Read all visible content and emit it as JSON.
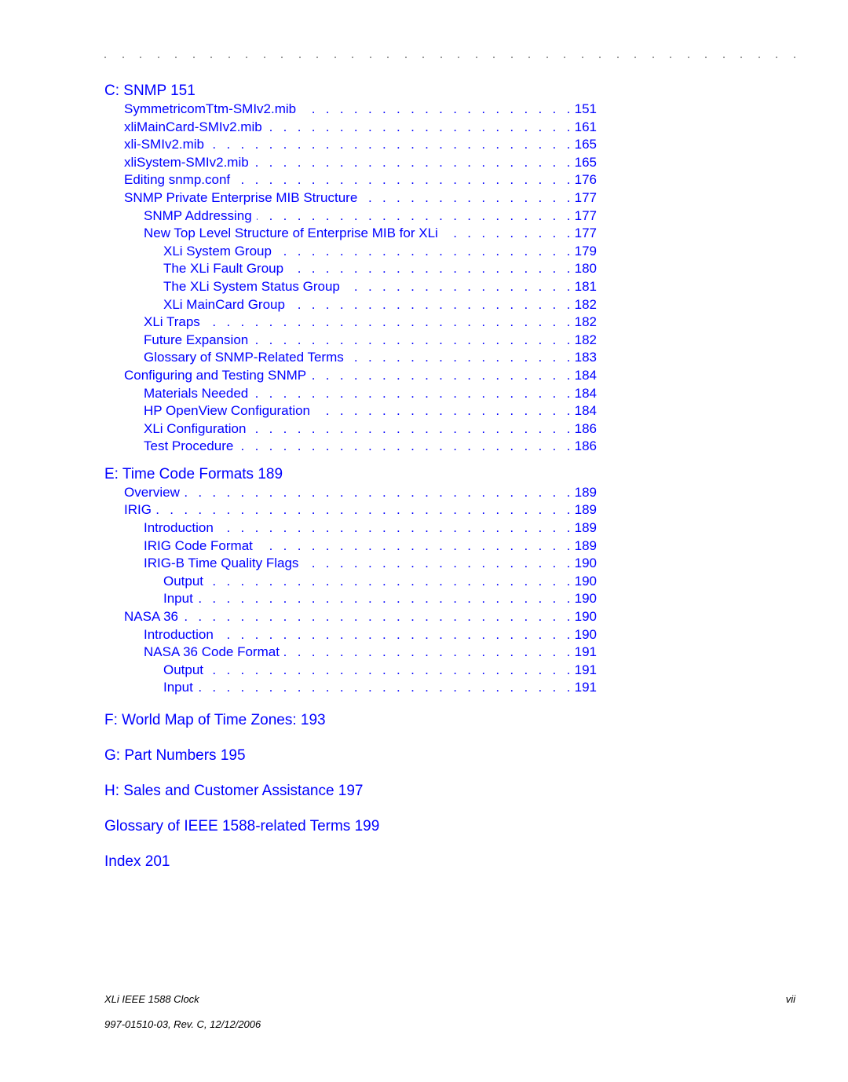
{
  "colors": {
    "link": "#0000ff",
    "footer": "#000000",
    "rule_dots": "#9a9a9a"
  },
  "sections": {
    "c": {
      "heading": "C: SNMP 151",
      "entries": [
        {
          "title": "SymmetricomTtm-SMIv2.mib",
          "page": "151",
          "level": 1
        },
        {
          "title": "xliMainCard-SMIv2.mib",
          "page": "161",
          "level": 1
        },
        {
          "title": "xli-SMIv2.mib",
          "page": "165",
          "level": 1
        },
        {
          "title": "xliSystem-SMIv2.mib",
          "page": "165",
          "level": 1
        },
        {
          "title": "Editing snmp.conf",
          "page": "176",
          "level": 1
        },
        {
          "title": "SNMP Private Enterprise MIB Structure",
          "page": "177",
          "level": 1
        },
        {
          "title": "SNMP Addressing",
          "page": "177",
          "level": 2
        },
        {
          "title": "New Top Level Structure of Enterprise MIB for XLi",
          "page": "177",
          "level": 2
        },
        {
          "title": "XLi System Group",
          "page": "179",
          "level": 3
        },
        {
          "title": "The XLi Fault Group",
          "page": "180",
          "level": 3
        },
        {
          "title": "The XLi System Status Group",
          "page": "181",
          "level": 3
        },
        {
          "title": "XLi MainCard Group",
          "page": "182",
          "level": 3
        },
        {
          "title": "XLi Traps",
          "page": "182",
          "level": 2
        },
        {
          "title": "Future Expansion",
          "page": "182",
          "level": 2
        },
        {
          "title": "Glossary of SNMP-Related Terms",
          "page": "183",
          "level": 2
        },
        {
          "title": "Configuring and Testing SNMP",
          "page": "184",
          "level": 1
        },
        {
          "title": "Materials Needed",
          "page": "184",
          "level": 2
        },
        {
          "title": "HP OpenView Configuration",
          "page": "184",
          "level": 2
        },
        {
          "title": "XLi Configuration",
          "page": "186",
          "level": 2
        },
        {
          "title": "Test Procedure",
          "page": "186",
          "level": 2
        }
      ]
    },
    "e": {
      "heading": "E: Time Code Formats 189",
      "entries": [
        {
          "title": "Overview",
          "page": "189",
          "level": 1
        },
        {
          "title": "IRIG",
          "page": "189",
          "level": 1
        },
        {
          "title": "Introduction",
          "page": "189",
          "level": 2
        },
        {
          "title": "IRIG Code Format",
          "page": "189",
          "level": 2
        },
        {
          "title": "IRIG-B Time Quality Flags",
          "page": "190",
          "level": 2
        },
        {
          "title": "Output",
          "page": "190",
          "level": 3
        },
        {
          "title": "Input",
          "page": "190",
          "level": 3
        },
        {
          "title": "NASA 36",
          "page": "190",
          "level": 1
        },
        {
          "title": "Introduction",
          "page": "190",
          "level": 2
        },
        {
          "title": "NASA 36 Code Format",
          "page": "191",
          "level": 2
        },
        {
          "title": "Output",
          "page": "191",
          "level": 3
        },
        {
          "title": "Input",
          "page": "191",
          "level": 3
        }
      ]
    }
  },
  "chapters": [
    "F: World Map of Time Zones: 193",
    "G: Part Numbers 195",
    "H: Sales and Customer Assistance 197",
    "Glossary of IEEE 1588-related Terms 199",
    "Index 201"
  ],
  "footer": {
    "product": "XLi IEEE 1588 Clock",
    "page_number": "vii",
    "doc_revision": "997-01510-03, Rev. C, 12/12/2006"
  }
}
